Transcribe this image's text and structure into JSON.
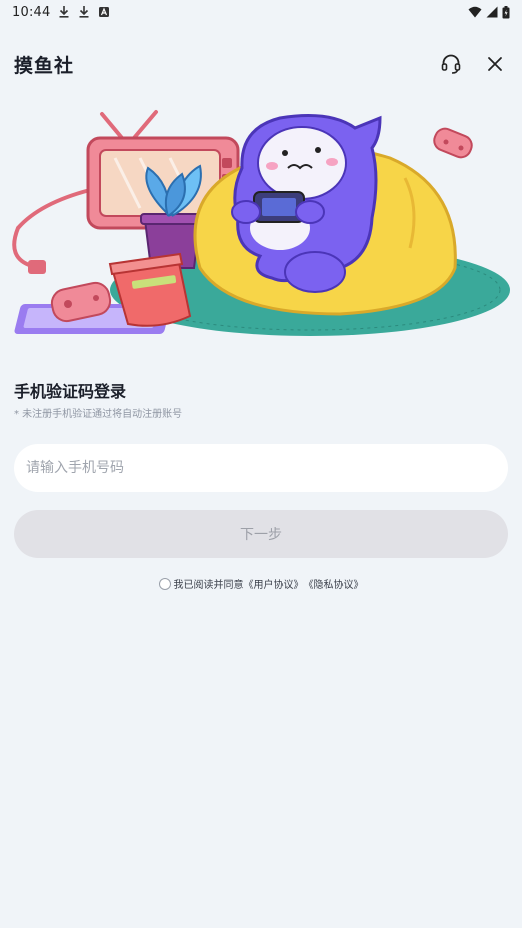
{
  "status_bar": {
    "time": "10:44",
    "left_icons": [
      "download-icon",
      "download-icon",
      "a-badge-icon"
    ],
    "right_icons": [
      "wifi-icon",
      "signal-icon",
      "battery-icon"
    ]
  },
  "header": {
    "title": "摸鱼社",
    "icons": [
      "headset-icon",
      "close-icon"
    ]
  },
  "login": {
    "title": "手机验证码登录",
    "hint": "* 未注册手机验证通过将自动注册账号",
    "phone_placeholder": "请输入手机号码",
    "next_label": "下一步",
    "agree_prefix": "我已阅读并同意",
    "user_agreement": "《用户协议》",
    "privacy_policy": "《隐私协议》"
  },
  "colors": {
    "background": "#f0f4f8",
    "input_bg": "#ffffff",
    "button_bg": "#e1e1e6",
    "button_text": "#9da0a8",
    "mascot": "#7b62f0",
    "beanbag": "#f7d548",
    "rug": "#3aa99a"
  }
}
